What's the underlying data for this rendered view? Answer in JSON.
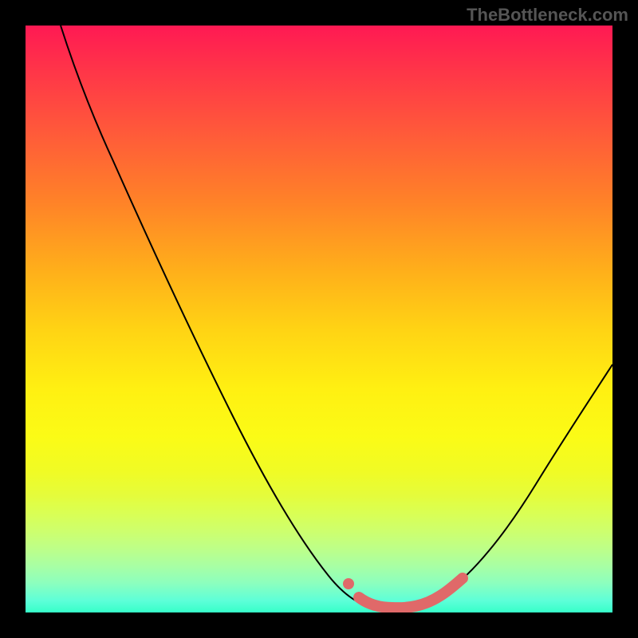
{
  "watermark": "TheBottleneck.com",
  "chart_data": {
    "type": "line",
    "title": "",
    "xlabel": "",
    "ylabel": "",
    "xlim": [
      0,
      100
    ],
    "ylim": [
      0,
      100
    ],
    "grid": false,
    "series": [
      {
        "name": "curve",
        "x": [
          6,
          12,
          18,
          24,
          30,
          36,
          42,
          48,
          54,
          58,
          62,
          66,
          70,
          76,
          82,
          88,
          94,
          100
        ],
        "values": [
          100,
          88,
          77,
          66,
          55,
          44,
          33,
          22,
          11,
          4,
          1,
          0,
          1,
          4,
          11,
          20,
          30,
          40
        ]
      }
    ],
    "annotations": [
      {
        "type": "highlighted_segment",
        "x_start": 57,
        "x_end": 74
      },
      {
        "type": "dot",
        "x": 57,
        "y": 7
      }
    ],
    "background_gradient": [
      "#ff1953",
      "#ffb01a",
      "#fff012",
      "#36ffc9"
    ]
  }
}
